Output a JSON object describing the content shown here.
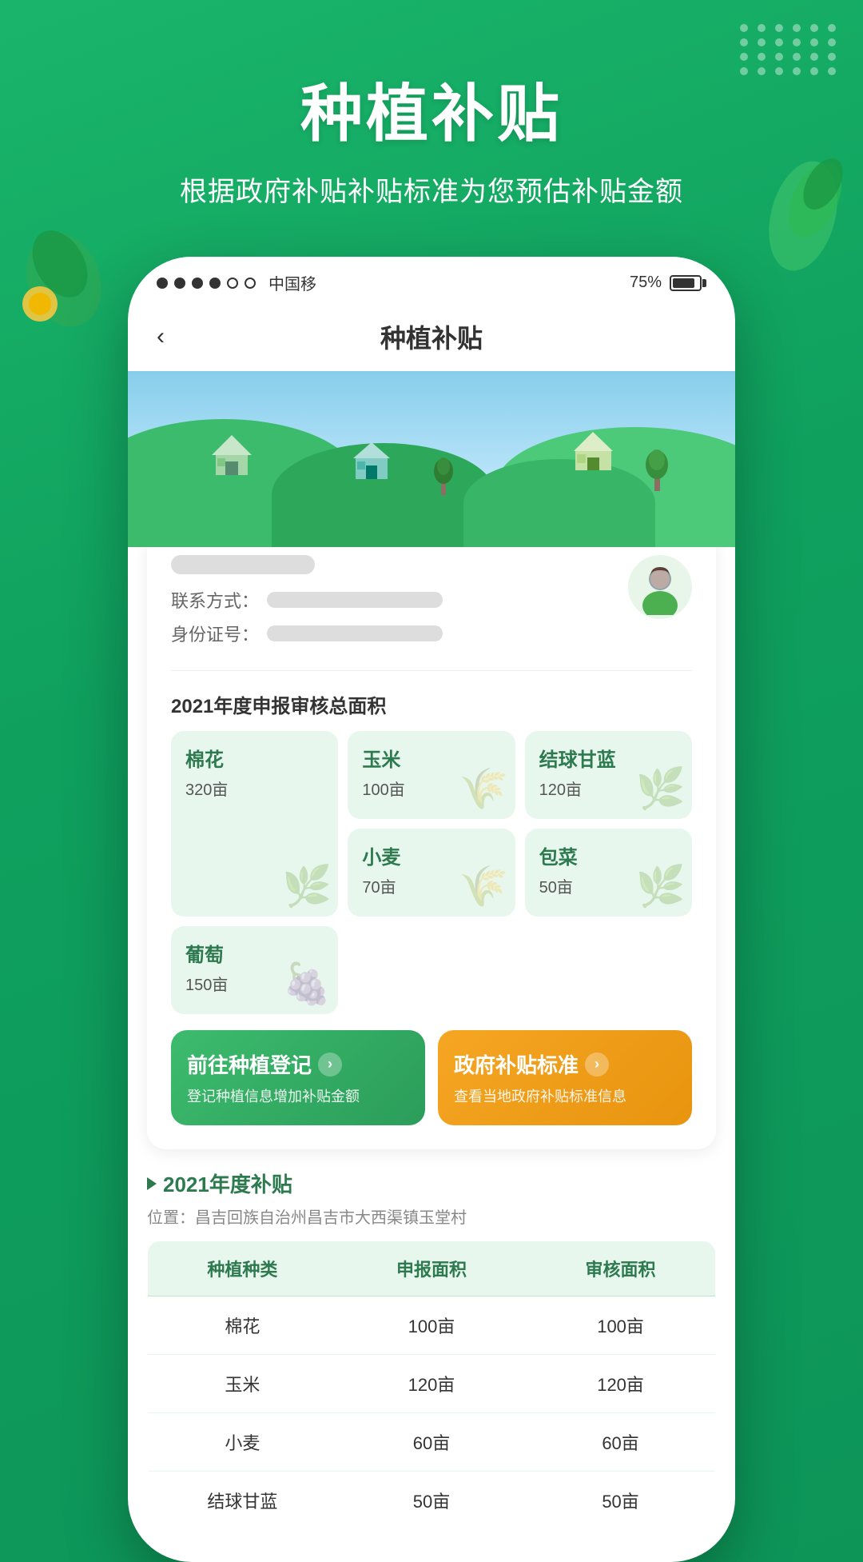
{
  "app": {
    "background_color": "#1ab56a"
  },
  "status_bar": {
    "carrier": "中国移",
    "battery_percent": "75%",
    "signals": [
      "filled",
      "filled",
      "filled",
      "filled",
      "empty",
      "empty"
    ]
  },
  "nav": {
    "back_icon": "‹",
    "title": "种植补贴"
  },
  "header": {
    "main_title": "种植补贴",
    "sub_title": "根据政府补贴补贴标准为您预估补贴金额"
  },
  "user": {
    "contact_label": "联系方式：",
    "id_label": "身份证号："
  },
  "crop_section": {
    "title": "2021年度申报审核总面积",
    "crops": [
      {
        "name": "棉花",
        "area": "320亩",
        "large": true
      },
      {
        "name": "玉米",
        "area": "100亩",
        "large": false
      },
      {
        "name": "结球甘蓝",
        "area": "120亩",
        "large": false
      },
      {
        "name": "小麦",
        "area": "70亩",
        "large": false
      },
      {
        "name": "包菜",
        "area": "50亩",
        "large": false
      },
      {
        "name": "葡萄",
        "area": "150亩",
        "large": false
      }
    ]
  },
  "action_buttons": {
    "register": {
      "title": "前往种植登记",
      "subtitle": "登记种植信息增加补贴金额",
      "arrow": "›"
    },
    "standard": {
      "title": "政府补贴标准",
      "subtitle": "查看当地政府补贴标准信息",
      "arrow": "›"
    }
  },
  "subsidy_section": {
    "year_label": "2021年度补贴",
    "location_label": "位置：昌吉回族自治州昌吉市大西渠镇玉堂村",
    "table": {
      "headers": [
        "种植种类",
        "申报面积",
        "审核面积"
      ],
      "rows": [
        {
          "type": "棉花",
          "declared": "100亩",
          "approved": "100亩"
        },
        {
          "type": "玉米",
          "declared": "120亩",
          "approved": "120亩"
        },
        {
          "type": "小麦",
          "declared": "60亩",
          "approved": "60亩"
        },
        {
          "type": "结球甘蓝",
          "declared": "50亩",
          "approved": "50亩"
        }
      ]
    }
  }
}
